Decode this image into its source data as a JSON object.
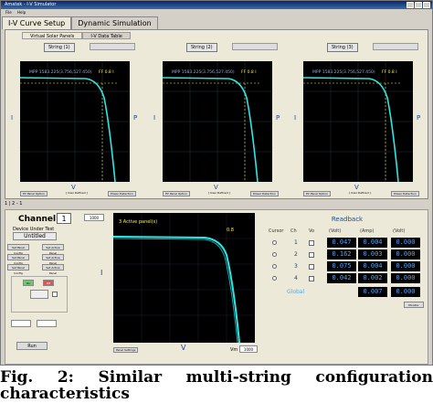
{
  "window": {
    "title": "Amatek - I-V Simulator",
    "menu": [
      "File",
      "Help"
    ]
  },
  "main_tabs": [
    "I-V Curve Setup",
    "Dynamic Simulation"
  ],
  "sub_tabs": [
    "Virtual Solar Panels",
    "I-V Data Table"
  ],
  "strings": [
    {
      "label": "String (1)",
      "mpp": "MPP 1583.225(3.756,527.450)",
      "ff": "FF 0.8 I",
      "left_axis": "I",
      "right_axis": "P",
      "xlabel": "V",
      "btn_left": "PV Panel Option",
      "btn_mid": "[ User Defined ]",
      "btn_right": "Power Detection"
    },
    {
      "label": "String (2)",
      "mpp": "MPP 1583.225(3.756,527.450)",
      "ff": "FF 0.8 I",
      "left_axis": "I",
      "right_axis": "P",
      "xlabel": "V",
      "btn_left": "PV Panel Option",
      "btn_mid": "[ User Defined ]",
      "btn_right": "Power Detection"
    },
    {
      "label": "String (3)",
      "mpp": "MPP 1583.225(3.756,527.450)",
      "ff": "FF 0.8 I",
      "left_axis": "I",
      "right_axis": "P",
      "xlabel": "V",
      "btn_left": "PV Panel Option",
      "btn_mid": "[ User Defined ]",
      "btn_right": "Power Detection"
    }
  ],
  "status_row": "1 | 2 - 1",
  "channel": {
    "label": "Channel",
    "value": "1",
    "dut_label": "Device Under Test",
    "dut_value": "Untitled"
  },
  "left_buttons": [
    "Set Panel Config",
    "Set Active Panel",
    "Set Panel Config",
    "Set Active Panel",
    "Set Panel Config",
    "Set Active Panel"
  ],
  "on_label": "On",
  "off_label": "Off",
  "run_label": "Run",
  "lower_plot": {
    "title": "3 Active panel(s)",
    "ff_label": "0.8",
    "xlabel": "V",
    "ylabel": "I",
    "vmax_label": "Vm",
    "vmax_value": "1000"
  },
  "readback": {
    "title": "Readback",
    "headers": [
      "Cursor",
      "Ch",
      "Vo",
      "Vo",
      "(Volt)",
      "(Amp)",
      "(Volt)"
    ],
    "rows": [
      {
        "ch": "1",
        "v": "0.047",
        "a": "0.004",
        "v2": "0.000"
      },
      {
        "ch": "2",
        "v": "0.162",
        "a": "0.003",
        "v2": "0.000"
      },
      {
        "ch": "3",
        "v": "0.075",
        "a": "0.004",
        "v2": "0.000"
      },
      {
        "ch": "4",
        "v": "0.042",
        "a": "0.002",
        "v2": "0.000"
      }
    ],
    "global_label": "Global",
    "global_v": "0.007",
    "global_a": "0.000",
    "monitor_label": "Monitor"
  },
  "caption": {
    "word1": "Fig.",
    "word2": "2:",
    "word3": "Similar",
    "word4": "multi-string",
    "word5": "configuration",
    "line2": "characteristics"
  },
  "chart_data": [
    {
      "type": "line",
      "title": "",
      "xlabel": "V",
      "ylabel": "I",
      "series": [
        {
          "values": [
            [
              0,
              1.0
            ],
            [
              0.6,
              0.99
            ],
            [
              0.75,
              0.96
            ],
            [
              0.85,
              0.75
            ],
            [
              0.92,
              0.3
            ],
            [
              0.96,
              0.0
            ]
          ]
        }
      ]
    },
    {
      "type": "line",
      "title": "",
      "xlabel": "V",
      "ylabel": "I",
      "series": [
        {
          "values": [
            [
              0,
              1.0
            ],
            [
              0.6,
              0.99
            ],
            [
              0.75,
              0.96
            ],
            [
              0.85,
              0.75
            ],
            [
              0.92,
              0.3
            ],
            [
              0.96,
              0.0
            ]
          ]
        }
      ]
    },
    {
      "type": "line",
      "title": "",
      "xlabel": "V",
      "ylabel": "I",
      "series": [
        {
          "values": [
            [
              0,
              1.0
            ],
            [
              0.6,
              0.99
            ],
            [
              0.75,
              0.96
            ],
            [
              0.85,
              0.75
            ],
            [
              0.92,
              0.3
            ],
            [
              0.96,
              0.0
            ]
          ]
        }
      ]
    },
    {
      "type": "line",
      "title": "3 Active panel(s)",
      "xlabel": "V",
      "ylabel": "I",
      "series": [
        {
          "values": [
            [
              0,
              1.0
            ],
            [
              0.6,
              0.99
            ],
            [
              0.75,
              0.96
            ],
            [
              0.85,
              0.75
            ],
            [
              0.92,
              0.3
            ],
            [
              0.96,
              0.0
            ]
          ]
        }
      ]
    }
  ]
}
